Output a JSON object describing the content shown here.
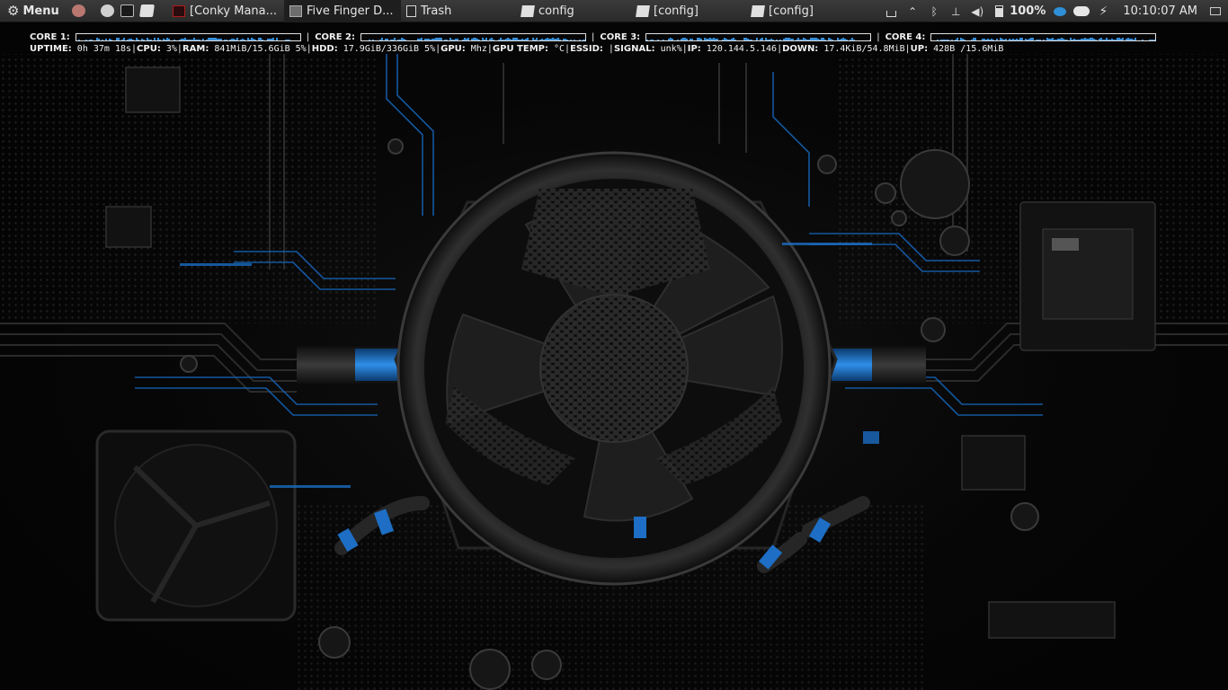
{
  "panel": {
    "menu_label": "Menu",
    "launchers": [
      {
        "icon": "network-manager-icon",
        "color": "#b9776f"
      },
      {
        "icon": "file-manager-icon",
        "color": "#cfcfcf"
      },
      {
        "icon": "terminal-icon",
        "color": "#1a1a1a"
      },
      {
        "icon": "text-editor-icon",
        "color": "#e0e0e0"
      }
    ],
    "tasks": [
      {
        "label": "[Conky Mana...",
        "icon": "conky-manager-icon",
        "icon_color": "#b01c1c",
        "active": false
      },
      {
        "label": "Five Finger D...",
        "icon": "image-viewer-icon",
        "icon_color": "#9a9a9a",
        "active": true
      },
      {
        "label": "Trash",
        "icon": "trash-icon",
        "icon_color": "#d6d6d6",
        "active": false
      },
      {
        "label": "config",
        "icon": "text-editor-icon",
        "icon_color": "#e0e0e0",
        "active": false
      },
      {
        "label": "[config]",
        "icon": "text-editor-icon",
        "icon_color": "#e0e0e0",
        "active": false
      },
      {
        "label": "[config]",
        "icon": "text-editor-icon",
        "icon_color": "#e0e0e0",
        "active": false
      }
    ],
    "tray": {
      "icons": [
        "tray-window-icon",
        "chevron-up-icon",
        "bluetooth-icon",
        "network-wired-icon",
        "volume-icon",
        "battery-icon"
      ],
      "battery_percent": "100%",
      "extra_icons": [
        "messaging-icon",
        "cloud-icon",
        "power-icon"
      ],
      "clock": "10:10:07 AM",
      "show_desktop_icon": "show-desktop-icon"
    }
  },
  "conky": {
    "cores": [
      {
        "label": "CORE 1:"
      },
      {
        "label": "CORE 2:"
      },
      {
        "label": "CORE 3:"
      },
      {
        "label": "CORE 4:"
      }
    ],
    "separator": "|",
    "stats": [
      {
        "label": "UPTIME:",
        "value": " 0h 37m 18s"
      },
      {
        "label": "CPU:",
        "value": " 3%"
      },
      {
        "label": "RAM:",
        "value": " 841MiB/15.6GiB 5%"
      },
      {
        "label": "HDD:",
        "value": " 17.9GiB/336GiB 5%"
      },
      {
        "label": "GPU:",
        "value": " Mhz"
      },
      {
        "label": "GPU TEMP:",
        "value": " °C"
      },
      {
        "label": "ESSID:",
        "value": " "
      },
      {
        "label": "SIGNAL:",
        "value": " unk%"
      },
      {
        "label": "IP:",
        "value": " 120.144.5.146"
      },
      {
        "label": "DOWN:",
        "value": " 17.4KiB/54.8MiB"
      },
      {
        "label": "UP:",
        "value": " 428B  /15.6MiB"
      }
    ],
    "graph_color": "#3a8fd8"
  },
  "wallpaper": {
    "accent": "#1d7ad6"
  }
}
